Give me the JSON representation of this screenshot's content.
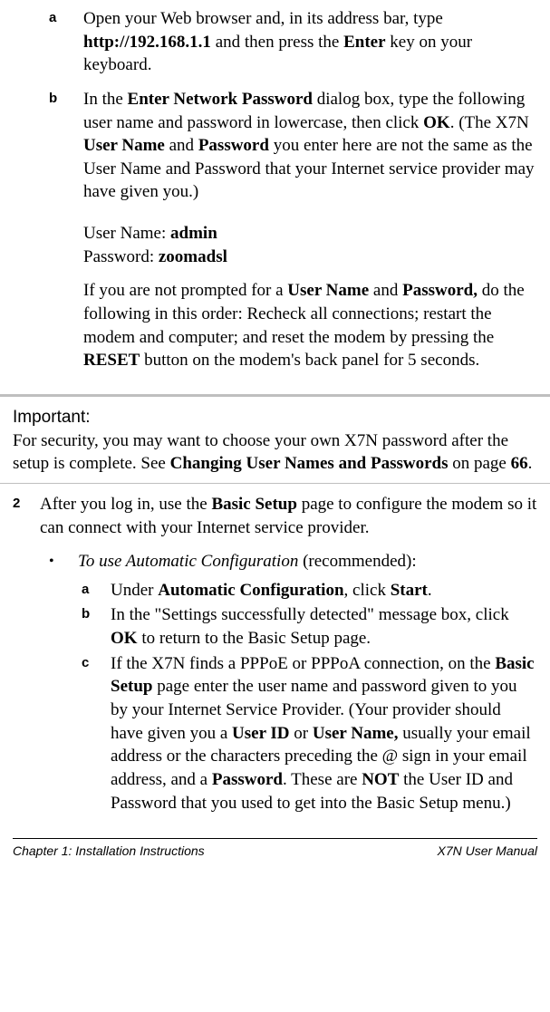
{
  "step_a": {
    "letter": "a",
    "t1": "Open your Web browser and, in its address bar, type ",
    "url": "http://192.168.1.1",
    "t2": " and then press the ",
    "enter": "Enter",
    "t3": " key on your keyboard."
  },
  "step_b": {
    "letter": "b",
    "t1": "In the ",
    "dlg": "Enter Network Password",
    "t2": " dialog box, type the following user name and password in lowercase, then click ",
    "ok": "OK",
    "t3": ". (The X7N ",
    "un": "User Name",
    "t4": " and ",
    "pw": "Password",
    "t5": " you enter here are not the same as the User Name and Password that your Internet service provider may have given you.)",
    "cred_un_label": "User Name: ",
    "cred_un_val": "admin",
    "cred_pw_label": "Password: ",
    "cred_pw_val": "zoomadsl",
    "p2_t1": "If you are not prompted for a ",
    "p2_un": "User Name",
    "p2_t2": " and ",
    "p2_pw": "Password,",
    "p2_t3": " do the following in this order: Recheck all connections; restart the modem and computer; and reset the modem by pressing the ",
    "p2_reset": "RESET",
    "p2_t4": " button on the modem's back panel for 5 seconds."
  },
  "important": {
    "heading": "Important:",
    "t1": "For security, you may want to choose your own X7N password after the setup is complete. See ",
    "link": "Changing User Names and Passwords",
    "t2": " on page ",
    "page": "66",
    "t3": "."
  },
  "step2": {
    "num": "2",
    "t1": "After you log in, use the ",
    "bs": "Basic Setup",
    "t2": " page to configure the modem so it can connect with your Internet service provider."
  },
  "bullet": {
    "dot": "•",
    "ital": "To use Automatic Configuration",
    "rest": " (recommended):"
  },
  "sub_a": {
    "letter": "a",
    "t1": "Under ",
    "ac": "Automatic Configuration",
    "t2": ", click ",
    "start": "Start",
    "t3": "."
  },
  "sub_b": {
    "letter": "b",
    "t1": "In the \"Settings successfully detected\" message box, click ",
    "ok": "OK",
    "t2": " to return to the Basic Setup page."
  },
  "sub_c": {
    "letter": "c",
    "t1": "If the X7N finds a PPPoE or PPPoA connection, on the ",
    "bs": "Basic Setup",
    "t2": " page enter the user name and password given to you by your Internet Service Provider. (Your provider should have given you a ",
    "uid": "User ID",
    "t3": " or ",
    "un": "User Name,",
    "t4": " usually your email address or the characters preceding the @ sign in your email address, and a ",
    "pw": "Password",
    "t5": ".  These are ",
    "not": "NOT",
    "t6": " the User ID and Password that you used to get into the Basic Setup menu.)"
  },
  "footer": {
    "left": "Chapter 1: Installation Instructions",
    "right": "X7N User Manual"
  }
}
